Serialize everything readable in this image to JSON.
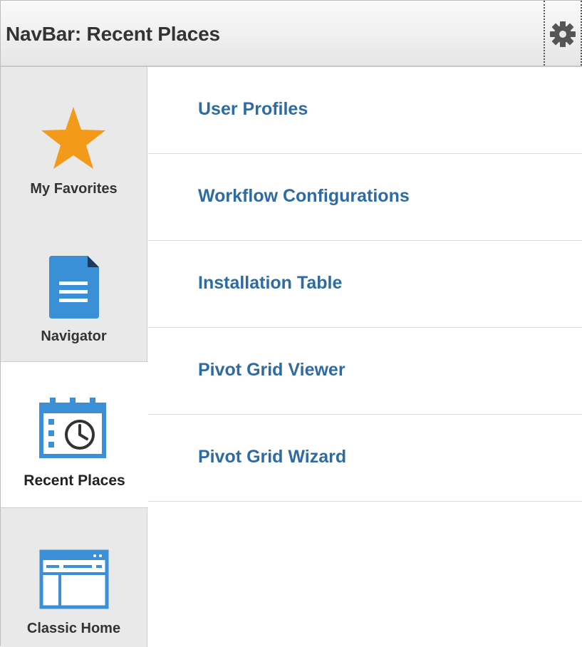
{
  "header": {
    "title": "NavBar: Recent Places",
    "settings_icon": "gear-icon"
  },
  "sidebar": {
    "tiles": [
      {
        "label": "My Favorites",
        "icon": "star-icon"
      },
      {
        "label": "Navigator",
        "icon": "document-icon"
      },
      {
        "label": "Recent Places",
        "icon": "calendar-clock-icon",
        "selected": true
      },
      {
        "label": "Classic Home",
        "icon": "browser-window-icon"
      }
    ]
  },
  "recent_places": {
    "items": [
      {
        "label": "User Profiles"
      },
      {
        "label": "Workflow Configurations"
      },
      {
        "label": "Installation Table"
      },
      {
        "label": "Pivot Grid Viewer"
      },
      {
        "label": "Pivot Grid Wizard"
      }
    ]
  },
  "colors": {
    "link": "#2e6ba3",
    "icon_blue": "#3a8fd6",
    "star": "#f49a1a",
    "sidebar_bg": "#e9e9e9"
  }
}
